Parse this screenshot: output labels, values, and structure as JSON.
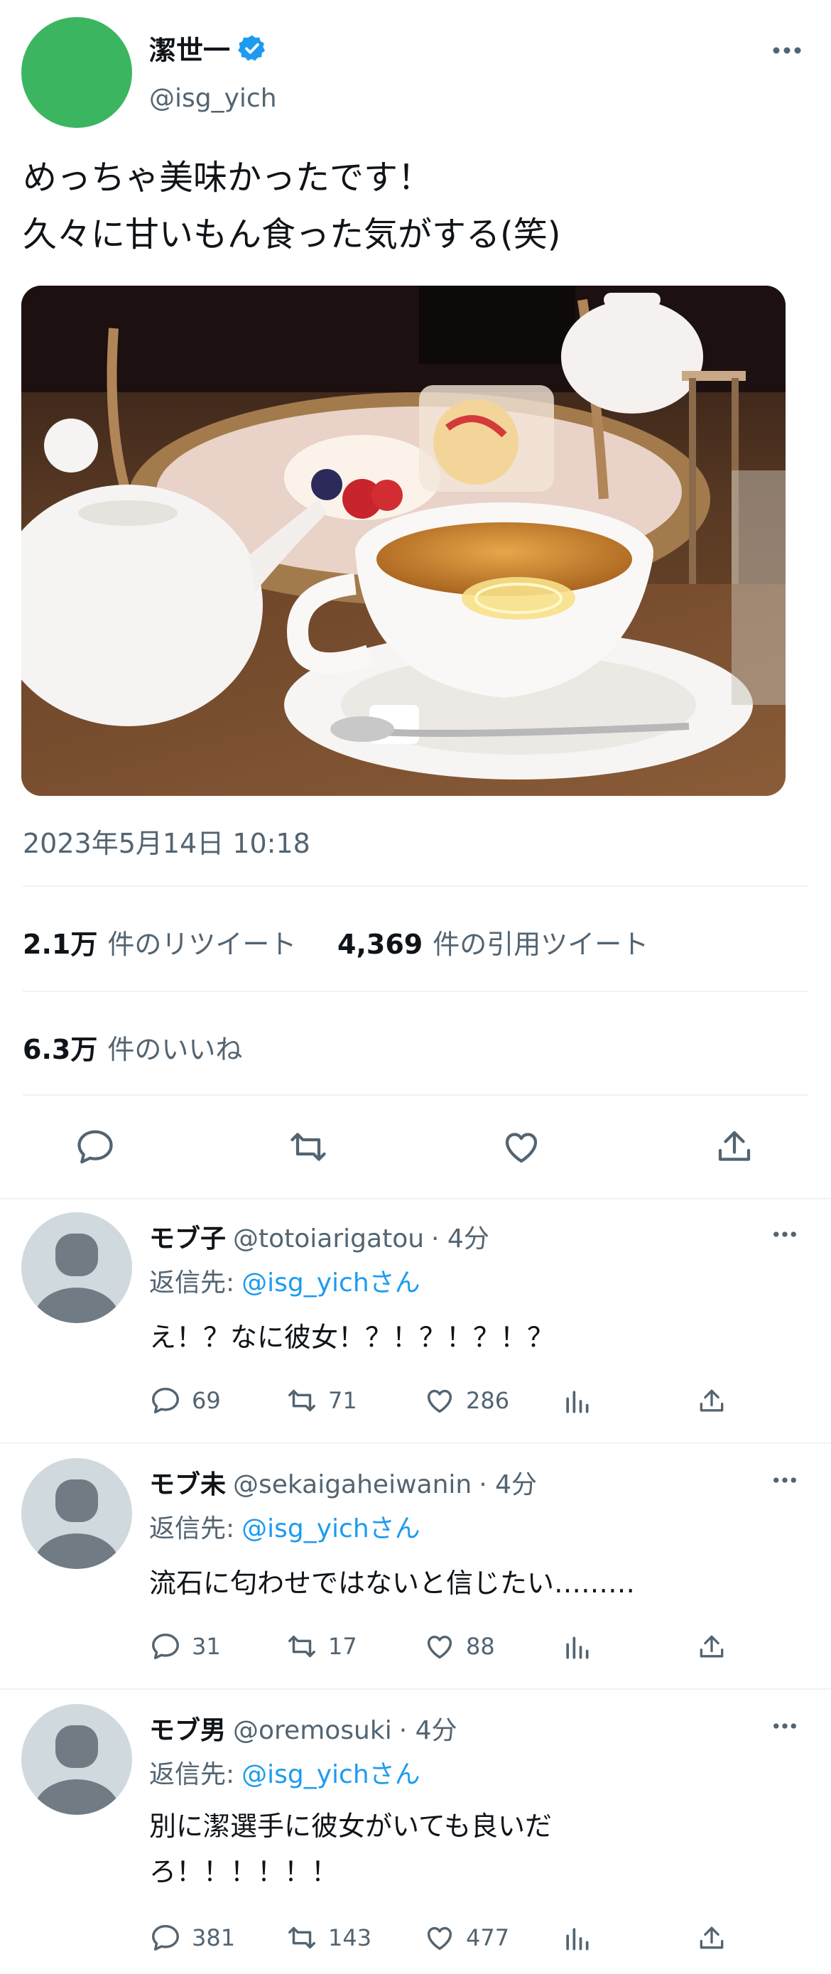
{
  "post": {
    "author_name": "潔世一",
    "author_handle": "@isg_yich",
    "text_line1": "めっちゃ美味かったです！",
    "text_line2": "久々に甘いもん食った気がする(笑)",
    "timestamp": "2023年5月14日 10:18",
    "retweets_count": "2.1万",
    "retweets_label": "件のリツイート",
    "quotes_count": "4,369",
    "quotes_label": "件の引用ツイート",
    "likes_count": "6.3万",
    "likes_label": "件のいいね"
  },
  "replies": [
    {
      "name": "モブ子",
      "handle": "@totoiarigatou",
      "time": "· 4分",
      "reply_to_label": "返信先:",
      "reply_to_handle": "@isg_yichさん",
      "text_line1": "え！？なに彼女！？！？！？！？",
      "text_line2": "",
      "replies": "69",
      "retweets": "71",
      "likes": "286"
    },
    {
      "name": "モブ未",
      "handle": "@sekaigaheiwanin",
      "time": "· 4分",
      "reply_to_label": "返信先:",
      "reply_to_handle": "@isg_yichさん",
      "text_line1": "流石に匂わせではないと信じたい………",
      "text_line2": "",
      "replies": "31",
      "retweets": "17",
      "likes": "88"
    },
    {
      "name": "モブ男",
      "handle": "@oremosuki",
      "time": "· 4分",
      "reply_to_label": "返信先:",
      "reply_to_handle": "@isg_yichさん",
      "text_line1": "別に潔選手に彼女がいても良いだ",
      "text_line2": "ろ！！！！！！",
      "replies": "381",
      "retweets": "143",
      "likes": "477"
    }
  ],
  "icons": {
    "verified": "verified-badge-icon",
    "more": "more-icon",
    "reply": "reply-icon",
    "retweet": "retweet-icon",
    "like": "like-icon",
    "share": "share-icon",
    "analytics": "analytics-icon"
  },
  "colors": {
    "accent": "#1d9bf0",
    "avatar_main": "#3cb561",
    "avatar_default": "#cfd9de",
    "muted_text": "#536471"
  }
}
